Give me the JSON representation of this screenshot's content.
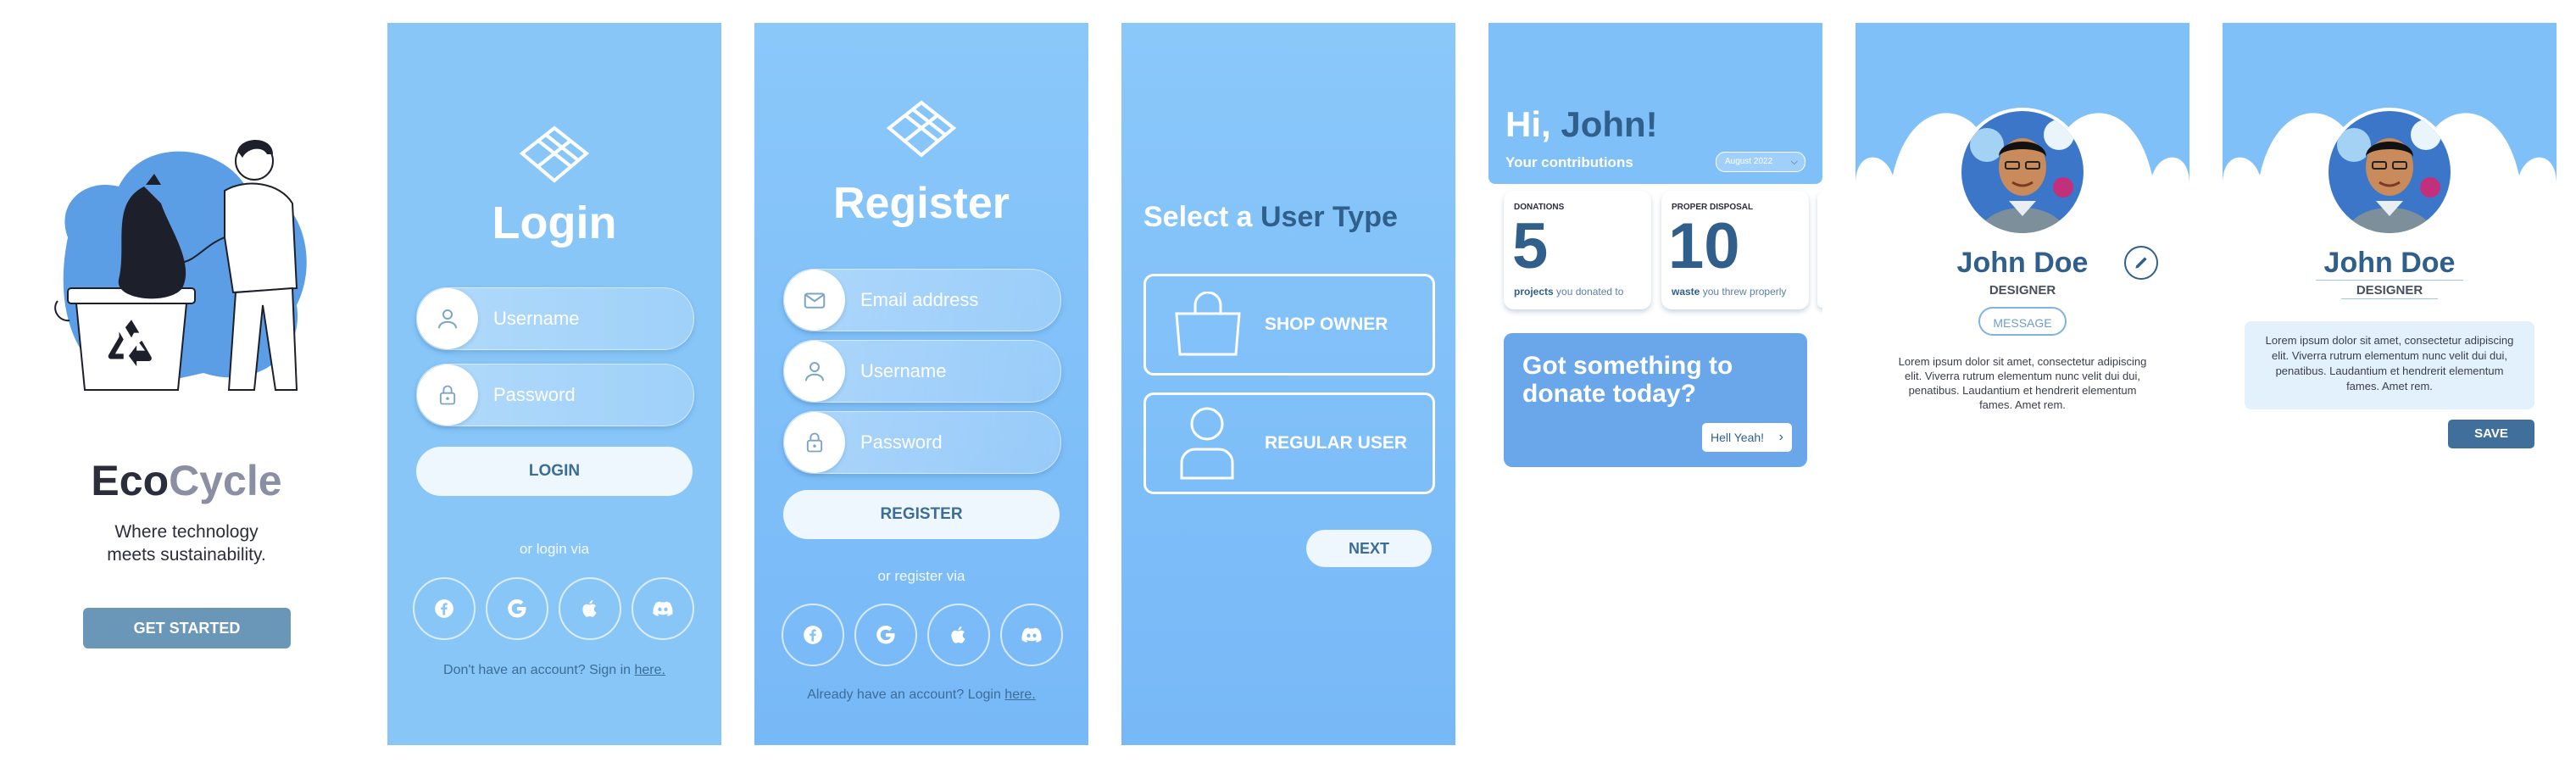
{
  "colors": {
    "accent_dark": "#2f5f8a",
    "sky_blue": "#80c0f8",
    "button_slate": "#6a96b8",
    "button_navy": "#3f6f9a",
    "gray_text": "#8a8fa3"
  },
  "splash": {
    "brand_part1": "Eco",
    "brand_part2": "Cycle",
    "tagline_line1": "Where technology",
    "tagline_line2": "meets sustainability.",
    "cta": "GET STARTED",
    "illustration": "person-recycling-illustration",
    "icon": "recycle-icon"
  },
  "login": {
    "title": "Login",
    "username_placeholder": "Username",
    "password_placeholder": "Password",
    "button": "LOGIN",
    "divider": "or login via",
    "socials": [
      "facebook-icon",
      "google-icon",
      "apple-icon",
      "discord-icon"
    ],
    "footer_text": "Don't have an account? Sign in ",
    "footer_link": "here."
  },
  "register": {
    "title": "Register",
    "email_placeholder": "Email address",
    "username_placeholder": "Username",
    "password_placeholder": "Password",
    "button": "REGISTER",
    "divider": "or register via",
    "footer_text": "Already have an account? Login ",
    "footer_link": "here."
  },
  "user_type": {
    "title_part1": "Select a ",
    "title_part2": "User Type",
    "option1": "SHOP OWNER",
    "option2": "REGULAR USER",
    "next": "NEXT"
  },
  "dashboard": {
    "greeting_part1": "Hi, ",
    "greeting_part2": "John!",
    "subtitle": "Your contributions",
    "month": "August 2022",
    "card1": {
      "label": "DONATIONS",
      "value": "5",
      "caption_bold": "projects",
      "caption": " you donated to"
    },
    "card2": {
      "label": "PROPER DISPOSAL",
      "value": "10",
      "caption_bold": "waste",
      "caption": " you threw properly"
    },
    "banner_line1": "Got something to",
    "banner_line2": "donate today?",
    "banner_button": "Hell Yeah!"
  },
  "profile": {
    "name": "John Doe",
    "role": "DESIGNER",
    "message_button": "MESSAGE",
    "bio": "Lorem ipsum dolor sit amet, consectetur adipiscing elit. Viverra rutrum elementum nunc velit dui dui, penatibus. Laudantium et hendrerit elementum fames. Amet rem."
  },
  "profile_edit": {
    "name": "John Doe",
    "role": "DESIGNER",
    "bio": "Lorem ipsum dolor sit amet, consectetur adipiscing elit. Viverra rutrum elementum nunc velit dui dui, penatibus. Laudantium et hendrerit elementum fames. Amet rem.",
    "save": "SAVE"
  }
}
